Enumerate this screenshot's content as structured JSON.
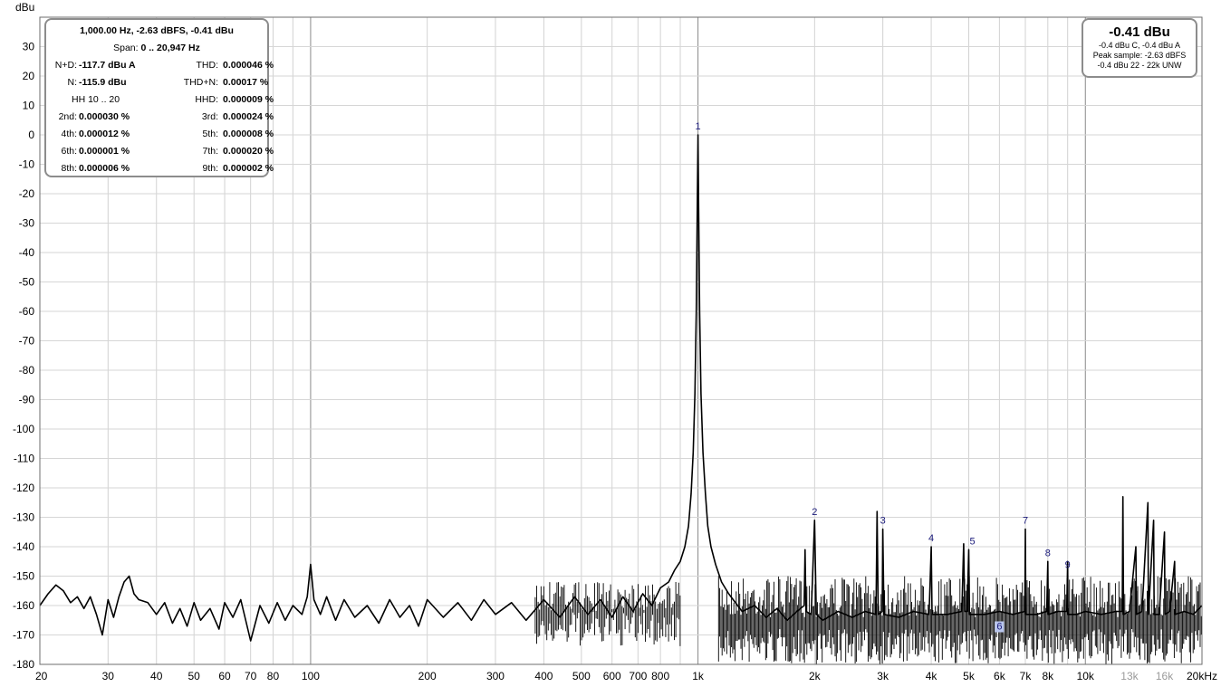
{
  "chart_data": {
    "type": "line",
    "ylabel": "dBu",
    "x_scale": "log",
    "xlim": [
      20,
      20000
    ],
    "ylim": [
      -180,
      40
    ],
    "x_tick_labels": [
      {
        "v": 20,
        "t": "20"
      },
      {
        "v": 30,
        "t": "30"
      },
      {
        "v": 40,
        "t": "40"
      },
      {
        "v": 50,
        "t": "50"
      },
      {
        "v": 60,
        "t": "60"
      },
      {
        "v": 70,
        "t": "70"
      },
      {
        "v": 80,
        "t": "80"
      },
      {
        "v": 100,
        "t": "100"
      },
      {
        "v": 200,
        "t": "200"
      },
      {
        "v": 300,
        "t": "300"
      },
      {
        "v": 400,
        "t": "400"
      },
      {
        "v": 500,
        "t": "500"
      },
      {
        "v": 600,
        "t": "600"
      },
      {
        "v": 700,
        "t": "700"
      },
      {
        "v": 800,
        "t": "800"
      },
      {
        "v": 1000,
        "t": "1k"
      },
      {
        "v": 2000,
        "t": "2k"
      },
      {
        "v": 3000,
        "t": "3k"
      },
      {
        "v": 4000,
        "t": "4k"
      },
      {
        "v": 5000,
        "t": "5k"
      },
      {
        "v": 6000,
        "t": "6k"
      },
      {
        "v": 7000,
        "t": "7k"
      },
      {
        "v": 8000,
        "t": "8k"
      },
      {
        "v": 10000,
        "t": "10k"
      },
      {
        "v": 13000,
        "t": "13k",
        "dim": true
      },
      {
        "v": 16000,
        "t": "16k",
        "dim": true
      },
      {
        "v": 20000,
        "t": "20kHz"
      }
    ],
    "y_tick_labels": [
      "30",
      "20",
      "10",
      "0",
      "-10",
      "-20",
      "-30",
      "-40",
      "-50",
      "-60",
      "-70",
      "-80",
      "-90",
      "-100",
      "-110",
      "-120",
      "-130",
      "-140",
      "-150",
      "-160",
      "-170",
      "-180"
    ],
    "grid": true,
    "series": [
      {
        "color": "#000000",
        "points": [
          [
            20,
            -160
          ],
          [
            21,
            -156
          ],
          [
            22,
            -153
          ],
          [
            23,
            -155
          ],
          [
            24,
            -159
          ],
          [
            25,
            -157
          ],
          [
            26,
            -161
          ],
          [
            27,
            -157
          ],
          [
            28,
            -163
          ],
          [
            29,
            -170
          ],
          [
            30,
            -158
          ],
          [
            31,
            -164
          ],
          [
            32,
            -157
          ],
          [
            33,
            -152
          ],
          [
            34,
            -150
          ],
          [
            35,
            -156
          ],
          [
            36,
            -158
          ],
          [
            38,
            -159
          ],
          [
            40,
            -163
          ],
          [
            42,
            -159
          ],
          [
            44,
            -166
          ],
          [
            46,
            -161
          ],
          [
            48,
            -167
          ],
          [
            50,
            -159
          ],
          [
            52,
            -165
          ],
          [
            55,
            -161
          ],
          [
            58,
            -168
          ],
          [
            60,
            -159
          ],
          [
            63,
            -164
          ],
          [
            66,
            -158
          ],
          [
            70,
            -172
          ],
          [
            74,
            -160
          ],
          [
            78,
            -166
          ],
          [
            82,
            -159
          ],
          [
            86,
            -165
          ],
          [
            90,
            -160
          ],
          [
            95,
            -163
          ],
          [
            98,
            -157
          ],
          [
            100,
            -146
          ],
          [
            102,
            -158
          ],
          [
            106,
            -163
          ],
          [
            110,
            -157
          ],
          [
            116,
            -165
          ],
          [
            122,
            -158
          ],
          [
            130,
            -164
          ],
          [
            140,
            -160
          ],
          [
            150,
            -166
          ],
          [
            160,
            -158
          ],
          [
            170,
            -164
          ],
          [
            180,
            -160
          ],
          [
            190,
            -167
          ],
          [
            200,
            -158
          ],
          [
            220,
            -164
          ],
          [
            240,
            -159
          ],
          [
            260,
            -165
          ],
          [
            280,
            -158
          ],
          [
            300,
            -163
          ],
          [
            330,
            -159
          ],
          [
            360,
            -165
          ],
          [
            400,
            -158
          ],
          [
            440,
            -164
          ],
          [
            480,
            -157
          ],
          [
            520,
            -163
          ],
          [
            560,
            -158
          ],
          [
            600,
            -164
          ],
          [
            640,
            -157
          ],
          [
            680,
            -162
          ],
          [
            720,
            -156
          ],
          [
            760,
            -160
          ],
          [
            800,
            -154
          ],
          [
            840,
            -152
          ],
          [
            870,
            -148
          ],
          [
            900,
            -145
          ],
          [
            925,
            -140
          ],
          [
            945,
            -133
          ],
          [
            960,
            -122
          ],
          [
            972,
            -108
          ],
          [
            982,
            -88
          ],
          [
            990,
            -60
          ],
          [
            996,
            -25
          ],
          [
            1000,
            0
          ],
          [
            1004,
            -25
          ],
          [
            1010,
            -60
          ],
          [
            1018,
            -88
          ],
          [
            1030,
            -108
          ],
          [
            1045,
            -122
          ],
          [
            1060,
            -133
          ],
          [
            1080,
            -140
          ],
          [
            1110,
            -146
          ],
          [
            1150,
            -152
          ],
          [
            1200,
            -156
          ],
          [
            1300,
            -162
          ],
          [
            1400,
            -160
          ],
          [
            1500,
            -164
          ],
          [
            1600,
            -161
          ],
          [
            1700,
            -165
          ],
          [
            1800,
            -162
          ],
          [
            1880,
            -160
          ],
          [
            1890,
            -141
          ],
          [
            1900,
            -162
          ],
          [
            1960,
            -163
          ],
          [
            2000,
            -131
          ],
          [
            2020,
            -163
          ],
          [
            2100,
            -165
          ],
          [
            2300,
            -162
          ],
          [
            2500,
            -164
          ],
          [
            2700,
            -162
          ],
          [
            2880,
            -163
          ],
          [
            2900,
            -128
          ],
          [
            2920,
            -163
          ],
          [
            2990,
            -162
          ],
          [
            3000,
            -134
          ],
          [
            3020,
            -163
          ],
          [
            3300,
            -164
          ],
          [
            3600,
            -162
          ],
          [
            3950,
            -163
          ],
          [
            4000,
            -140
          ],
          [
            4020,
            -163
          ],
          [
            4400,
            -163
          ],
          [
            4800,
            -162
          ],
          [
            4850,
            -139
          ],
          [
            4880,
            -162
          ],
          [
            4950,
            -162
          ],
          [
            5000,
            -141
          ],
          [
            5020,
            -163
          ],
          [
            5500,
            -163
          ],
          [
            6000,
            -162
          ],
          [
            6500,
            -163
          ],
          [
            6980,
            -162
          ],
          [
            7000,
            -134
          ],
          [
            7020,
            -163
          ],
          [
            7500,
            -163
          ],
          [
            7950,
            -162
          ],
          [
            8000,
            -145
          ],
          [
            8020,
            -163
          ],
          [
            8500,
            -162
          ],
          [
            8950,
            -162
          ],
          [
            9000,
            -145
          ],
          [
            9020,
            -163
          ],
          [
            9500,
            -163
          ],
          [
            10000,
            -162
          ],
          [
            11000,
            -163
          ],
          [
            12000,
            -162
          ],
          [
            12450,
            -162
          ],
          [
            12500,
            -123
          ],
          [
            12550,
            -163
          ],
          [
            13000,
            -162
          ],
          [
            13500,
            -140
          ],
          [
            13550,
            -163
          ],
          [
            14000,
            -162
          ],
          [
            14500,
            -125
          ],
          [
            14550,
            -163
          ],
          [
            15000,
            -131
          ],
          [
            15050,
            -163
          ],
          [
            15500,
            -163
          ],
          [
            16000,
            -135
          ],
          [
            16050,
            -163
          ],
          [
            16500,
            -162
          ],
          [
            17000,
            -145
          ],
          [
            17050,
            -163
          ],
          [
            18000,
            -162
          ],
          [
            19000,
            -163
          ],
          [
            20000,
            -160
          ]
        ]
      }
    ],
    "markers": [
      {
        "label": "1",
        "x": 1000,
        "y": 0
      },
      {
        "label": "2",
        "x": 2000,
        "y": -131
      },
      {
        "label": "3",
        "x": 3000,
        "y": -134
      },
      {
        "label": "4",
        "x": 4000,
        "y": -140
      },
      {
        "label": "5",
        "x": 5000,
        "y": -141
      },
      {
        "label": "6",
        "x": 6000,
        "y": -170,
        "highlight": true
      },
      {
        "label": "7",
        "x": 7000,
        "y": -134
      },
      {
        "label": "8",
        "x": 8000,
        "y": -145
      },
      {
        "label": "9",
        "x": 9000,
        "y": -149
      }
    ]
  },
  "stats": {
    "header": "1,000.00 Hz, -2.63 dBFS, -0.41 dBu",
    "span_label": "Span:",
    "span_value": "0 .. 20,947 Hz",
    "rows": [
      {
        "l1": "N+D:",
        "v1": "-117.7 dBu A",
        "l2": "THD:",
        "v2": "0.000046 %"
      },
      {
        "l1": "N:",
        "v1": "-115.9 dBu",
        "l2": "THD+N:",
        "v2": "0.00017 %"
      },
      {
        "l1": "HH 10 .. 20",
        "v1": "",
        "l2": "HHD:",
        "v2": "0.000009 %"
      },
      {
        "l1": "2nd:",
        "v1": "0.000030 %",
        "l2": "3rd:",
        "v2": "0.000024 %"
      },
      {
        "l1": "4th:",
        "v1": "0.000012 %",
        "l2": "5th:",
        "v2": "0.000008 %"
      },
      {
        "l1": "6th:",
        "v1": "0.000001 %",
        "l2": "7th:",
        "v2": "0.000020 %"
      },
      {
        "l1": "8th:",
        "v1": "0.000006 %",
        "l2": "9th:",
        "v2": "0.000002 %"
      }
    ]
  },
  "level": {
    "main": "-0.41 dBu",
    "line1": "-0.4 dBu C, -0.4 dBu A",
    "line2": "Peak sample: -2.63 dBFS",
    "line3": "-0.4 dBu 22 - 22k UNW"
  }
}
